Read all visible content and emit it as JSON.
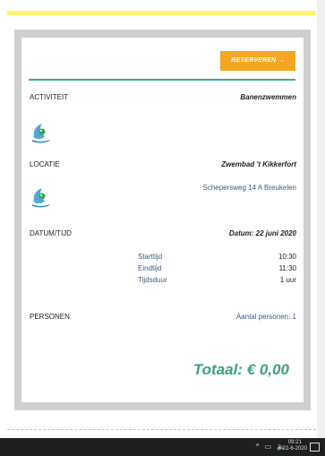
{
  "reserve_button": "RESERVEREN",
  "activity": {
    "label": "ACTIVITEIT",
    "value": "Banenzwemmen"
  },
  "location": {
    "label": "LOCATIE",
    "value": "Zwembad 't Kikkerfort",
    "address": "Schepersweg 14 A Breukelen"
  },
  "datetime": {
    "label": "DATUM/TIJD",
    "value": "Datum: 22 juni 2020",
    "rows": [
      {
        "label": "Starttijd",
        "value": "10:30"
      },
      {
        "label": "Eindtijd",
        "value": "11:30"
      },
      {
        "label": "Tijdsduur",
        "value": "1 uur"
      }
    ]
  },
  "persons": {
    "label": "PERSONEN",
    "value": "Aantal personen: 1"
  },
  "total": "Totaal: € 0,00",
  "taskbar": {
    "time": "09:21",
    "date": "22-6-2020"
  },
  "colors": {
    "accent": "#f5a623",
    "teal": "#3aa8a0",
    "total": "#3aa37f"
  }
}
